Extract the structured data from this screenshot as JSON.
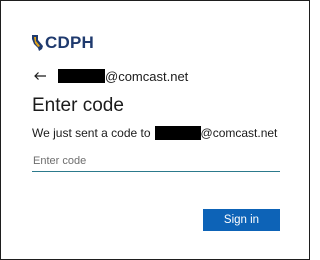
{
  "brand": {
    "logo_text": "CDPH"
  },
  "identity": {
    "email_domain": "@comcast.net"
  },
  "main": {
    "title": "Enter code",
    "description_prefix": "We just sent a code to",
    "description_domain": "@comcast.net",
    "code_placeholder": "Enter code",
    "code_value": ""
  },
  "actions": {
    "signin_label": "Sign in"
  },
  "colors": {
    "accent": "#0d63b7",
    "brand": "#1f3a6e",
    "input_underline": "#2c7a8c"
  }
}
